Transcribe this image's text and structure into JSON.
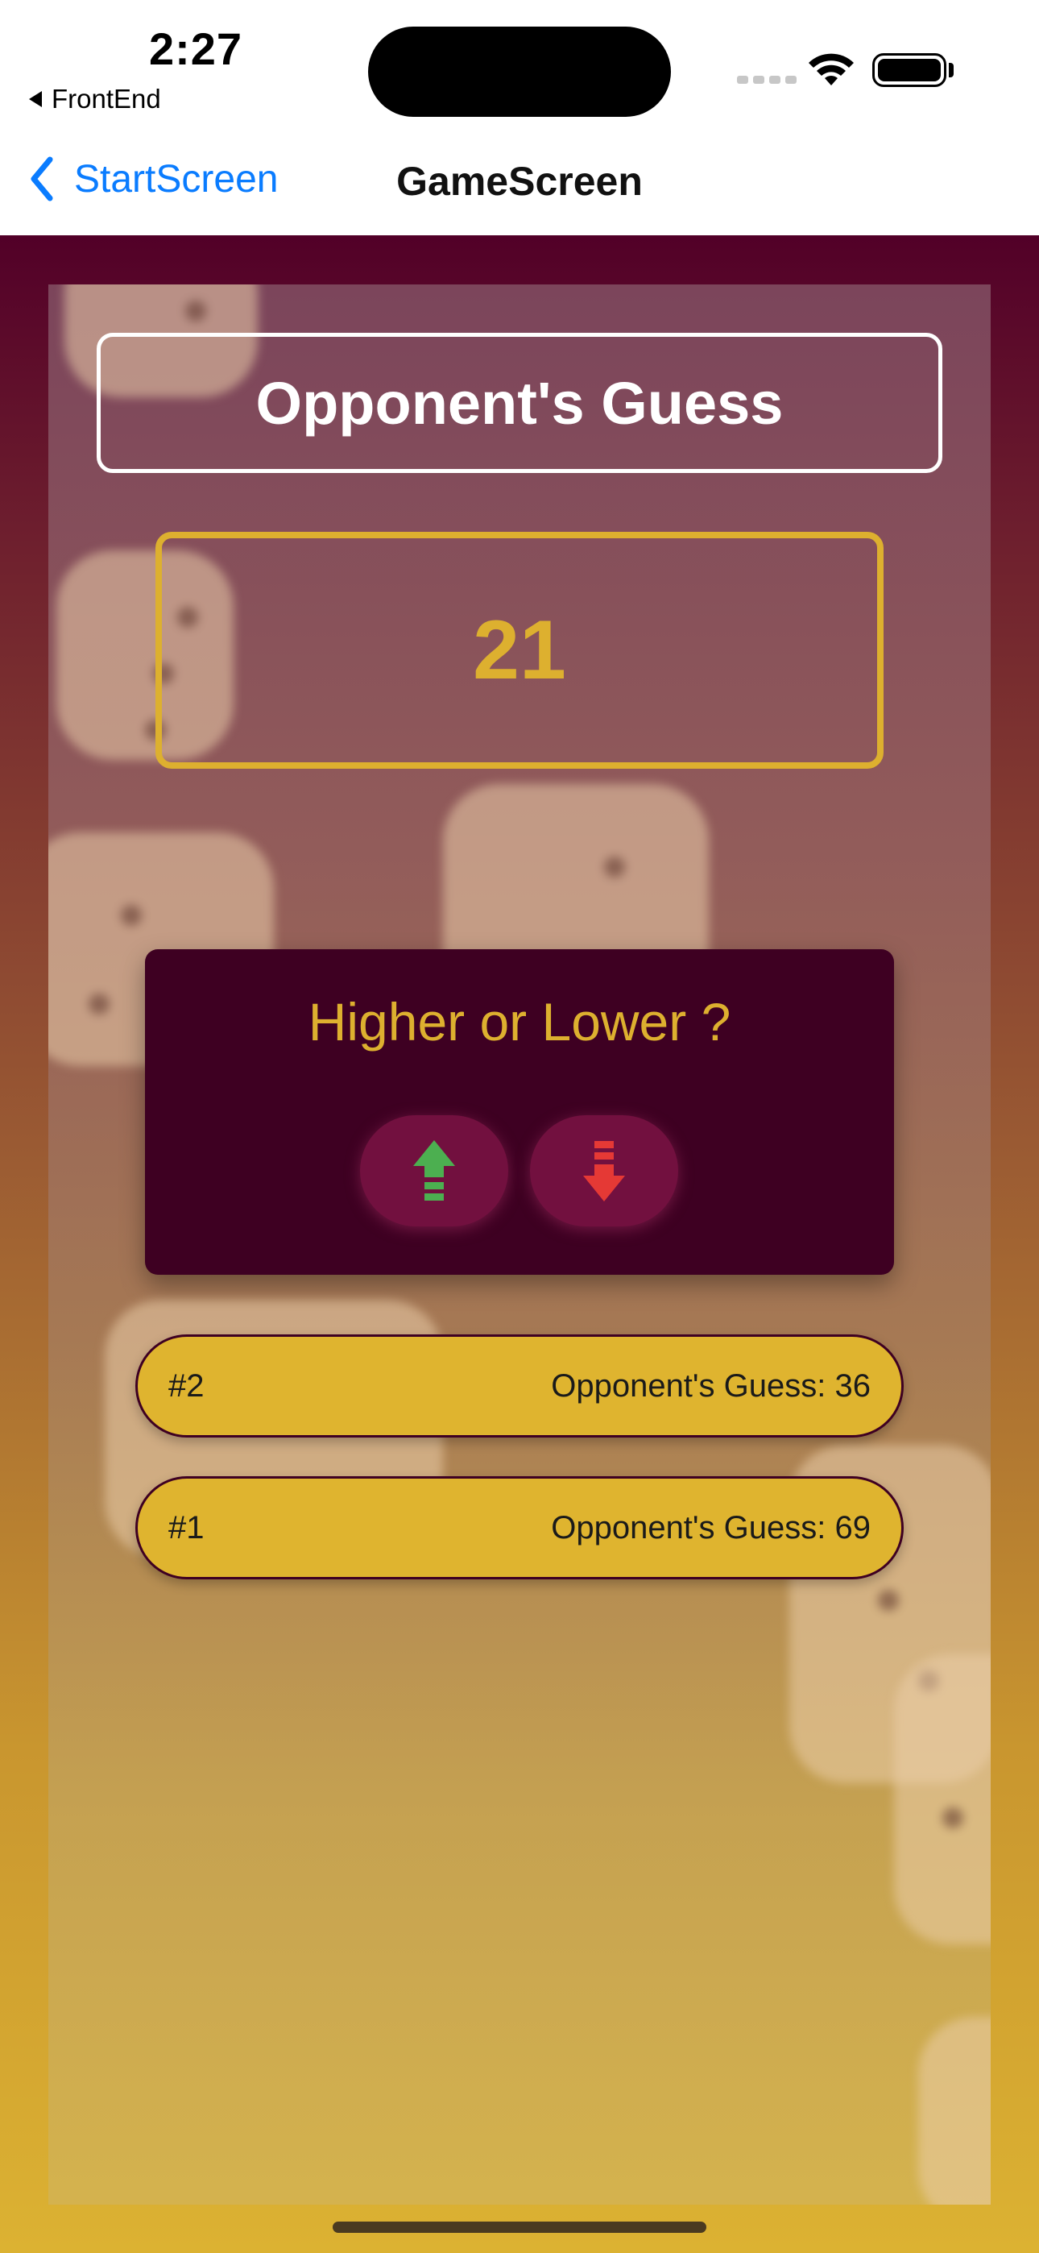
{
  "status_bar": {
    "time": "2:27",
    "back_app": "FrontEnd"
  },
  "nav": {
    "back_label": "StartScreen",
    "title": "GameScreen"
  },
  "game": {
    "title": "Opponent's Guess",
    "current_guess": "21",
    "prompt": "Higher or Lower ?",
    "controls": {
      "higher_icon": "arrow-up-icon",
      "lower_icon": "arrow-down-icon"
    },
    "log": [
      {
        "round": "#2",
        "text": "Opponent's Guess: 36"
      },
      {
        "round": "#1",
        "text": "Opponent's Guess: 69"
      }
    ]
  },
  "colors": {
    "accent": "#ddb02f",
    "card": "#3e0022",
    "button": "#72103f",
    "up_arrow": "#4caf50",
    "down_arrow": "#e53935",
    "ios_blue": "#0a7cff"
  }
}
